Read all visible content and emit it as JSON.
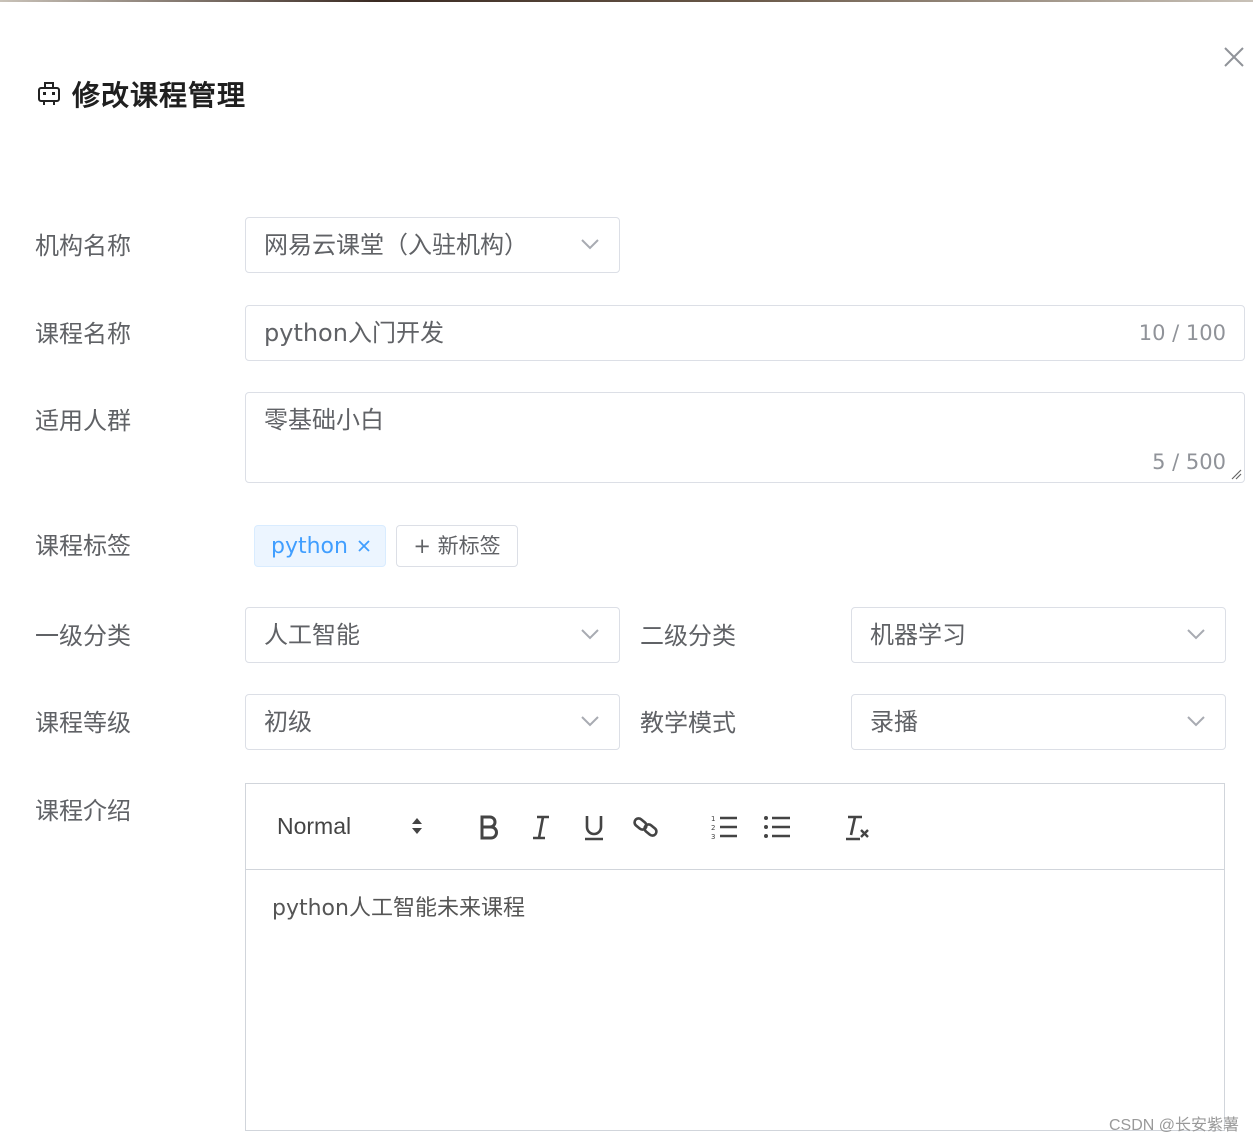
{
  "dialog": {
    "title": "修改课程管理",
    "close_icon": "close-icon",
    "title_icon": "robot-icon"
  },
  "form": {
    "org": {
      "label": "机构名称",
      "value": "网易云课堂（入驻机构）"
    },
    "course_name": {
      "label": "课程名称",
      "value": "python入门开发",
      "counter": "10 / 100"
    },
    "audience": {
      "label": "适用人群",
      "value": "零基础小白",
      "counter": "5 / 500"
    },
    "tags": {
      "label": "课程标签",
      "items": [
        "python"
      ],
      "new_tag_label": "+ 新标签"
    },
    "category1": {
      "label": "一级分类",
      "value": "人工智能"
    },
    "category2": {
      "label": "二级分类",
      "value": "机器学习"
    },
    "level": {
      "label": "课程等级",
      "value": "初级"
    },
    "mode": {
      "label": "教学模式",
      "value": "录播"
    },
    "intro": {
      "label": "课程介绍",
      "toolbar": {
        "header_value": "Normal",
        "buttons": [
          "bold-icon",
          "italic-icon",
          "underline-icon",
          "link-icon",
          "ordered-list-icon",
          "bullet-list-icon",
          "clear-format-icon"
        ]
      },
      "content": "python人工智能未来课程"
    }
  },
  "watermark": "CSDN @长安紫薯",
  "colors": {
    "tag_bg": "#ecf5ff",
    "tag_text": "#409eff",
    "border": "#dcdfe6",
    "label": "#606266"
  }
}
